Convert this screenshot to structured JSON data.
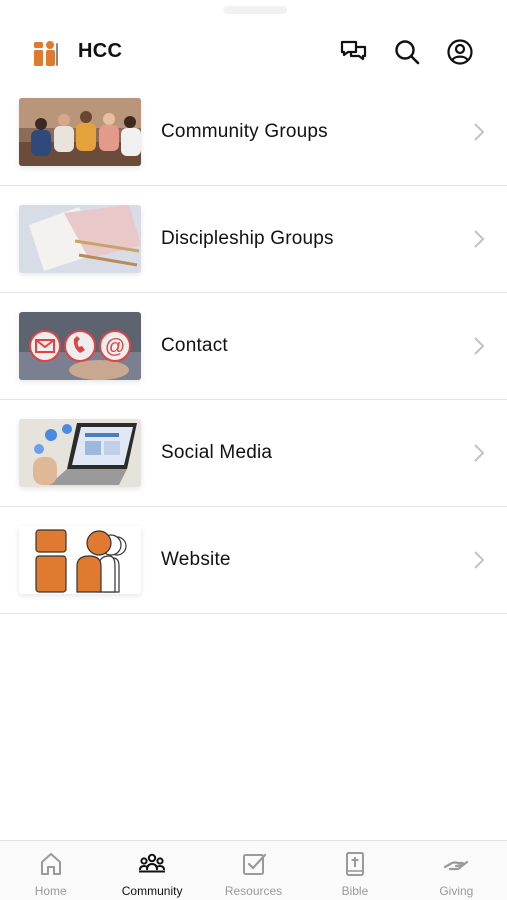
{
  "header": {
    "title": "HCC",
    "icons": {
      "logo": "hcc-logo-icon",
      "chat": "chat-bubbles-icon",
      "search": "search-icon",
      "profile": "profile-icon"
    }
  },
  "list": {
    "items": [
      {
        "label": "Community Groups",
        "thumbnail": "people-group-photo"
      },
      {
        "label": "Discipleship Groups",
        "thumbnail": "notebook-pencil-photo"
      },
      {
        "label": "Contact",
        "thumbnail": "contact-icons-photo"
      },
      {
        "label": "Social Media",
        "thumbnail": "laptop-social-photo"
      },
      {
        "label": "Website",
        "thumbnail": "hcc-logo-image"
      }
    ]
  },
  "bottom_nav": {
    "active": "Community",
    "items": [
      {
        "label": "Home",
        "icon": "home-icon"
      },
      {
        "label": "Community",
        "icon": "community-icon"
      },
      {
        "label": "Resources",
        "icon": "checkbox-icon"
      },
      {
        "label": "Bible",
        "icon": "bible-icon"
      },
      {
        "label": "Giving",
        "icon": "giving-hand-icon"
      }
    ]
  },
  "colors": {
    "brand_orange": "#E07A30",
    "text": "#111111",
    "muted": "#9A9A9A",
    "divider": "#E4E4E4"
  }
}
